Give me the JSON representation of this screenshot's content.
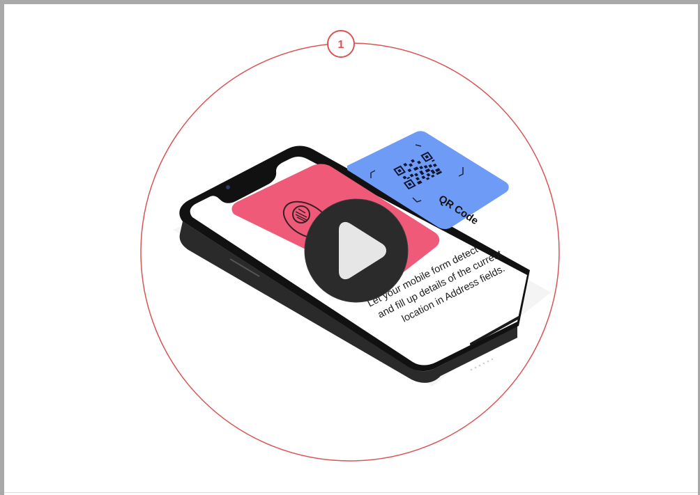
{
  "step": {
    "number": "1"
  },
  "qr_card": {
    "label": "QR Code"
  },
  "phone_screen": {
    "lines": [
      "Let your mobile form detect",
      "and fill up details of the current",
      "location in Address fields."
    ]
  },
  "video": {
    "control_icon": "play-icon"
  },
  "colors": {
    "circle_stroke": "#d95454",
    "qr_card": "#6e9bf5",
    "phone_card": "#ee5a77",
    "play_bg": "#2b2b2b",
    "play_icon": "#e6e6e6"
  }
}
